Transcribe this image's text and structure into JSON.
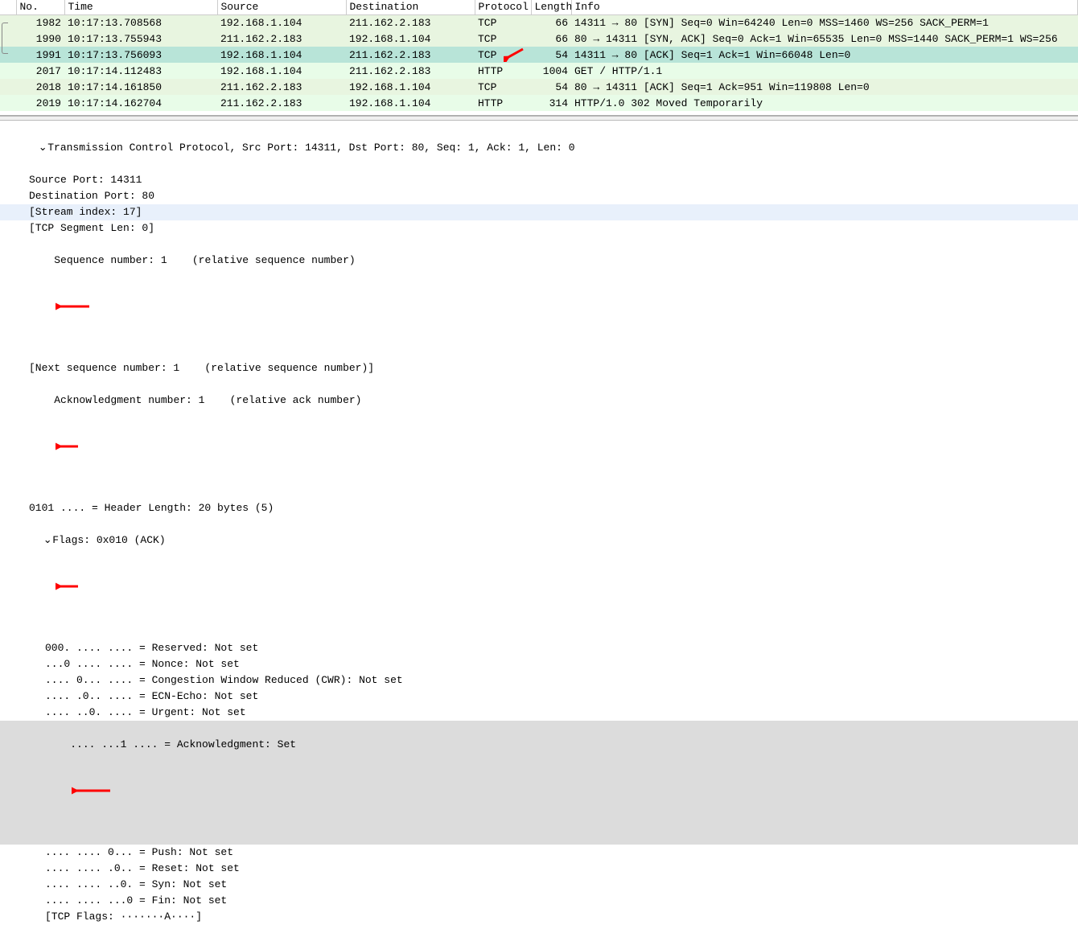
{
  "headers": {
    "no": "No.",
    "time": "Time",
    "source": "Source",
    "destination": "Destination",
    "protocol": "Protocol",
    "length": "Length",
    "info": "Info"
  },
  "packets": [
    {
      "no": "1982",
      "time": "10:17:13.708568",
      "src": "192.168.1.104",
      "dst": "211.162.2.183",
      "proto": "TCP",
      "len": "66",
      "info": "14311 → 80 [SYN] Seq=0 Win=64240 Len=0 MSS=1460 WS=256 SACK_PERM=1",
      "cls": "row-syn",
      "bracket": "top"
    },
    {
      "no": "1990",
      "time": "10:17:13.755943",
      "src": "211.162.2.183",
      "dst": "192.168.1.104",
      "proto": "TCP",
      "len": "66",
      "info": "80 → 14311 [SYN, ACK] Seq=0 Ack=1 Win=65535 Len=0 MSS=1440 SACK_PERM=1 WS=256",
      "cls": "row-synack",
      "bracket": "mid"
    },
    {
      "no": "1991",
      "time": "10:17:13.756093",
      "src": "192.168.1.104",
      "dst": "211.162.2.183",
      "proto": "TCP",
      "len": "54",
      "info": "14311 → 80 [ACK] Seq=1 Ack=1 Win=66048 Len=0",
      "cls": "row-ack",
      "bracket": "bot",
      "arrow_proto": true
    },
    {
      "no": "2017",
      "time": "10:17:14.112483",
      "src": "192.168.1.104",
      "dst": "211.162.2.183",
      "proto": "HTTP",
      "len": "1004",
      "info": "GET / HTTP/1.1",
      "cls": "row-http"
    },
    {
      "no": "2018",
      "time": "10:17:14.161850",
      "src": "211.162.2.183",
      "dst": "192.168.1.104",
      "proto": "TCP",
      "len": "54",
      "info": "80 → 14311 [ACK] Seq=1 Ack=951 Win=119808 Len=0",
      "cls": "row-tcpack"
    },
    {
      "no": "2019",
      "time": "10:17:14.162704",
      "src": "211.162.2.183",
      "dst": "192.168.1.104",
      "proto": "HTTP",
      "len": "314",
      "info": "HTTP/1.0 302 Moved Temporarily",
      "cls": "row-http2"
    }
  ],
  "details": {
    "tcp_header": "Transmission Control Protocol, Src Port: 14311, Dst Port: 80, Seq: 1, Ack: 1, Len: 0",
    "src_port": "Source Port: 14311",
    "dst_port": "Destination Port: 80",
    "stream_index": "[Stream index: 17]",
    "seg_len": "[TCP Segment Len: 0]",
    "seq_num": "Sequence number: 1    (relative sequence number)",
    "next_seq": "[Next sequence number: 1    (relative sequence number)]",
    "ack_num": "Acknowledgment number: 1    (relative ack number)",
    "hdr_len": "0101 .... = Header Length: 20 bytes (5)",
    "flags_header": "Flags: 0x010 (ACK)",
    "flag_reserved": "000. .... .... = Reserved: Not set",
    "flag_nonce": "...0 .... .... = Nonce: Not set",
    "flag_cwr": ".... 0... .... = Congestion Window Reduced (CWR): Not set",
    "flag_ecn": ".... .0.. .... = ECN-Echo: Not set",
    "flag_urg": ".... ..0. .... = Urgent: Not set",
    "flag_ack": ".... ...1 .... = Acknowledgment: Set",
    "flag_psh": ".... .... 0... = Push: Not set",
    "flag_rst": ".... .... .0.. = Reset: Not set",
    "flag_syn": ".... .... ..0. = Syn: Not set",
    "flag_fin": ".... .... ...0 = Fin: Not set",
    "tcp_flags": "[TCP Flags: ·······A····]"
  },
  "arrow_color": "#ff0000"
}
